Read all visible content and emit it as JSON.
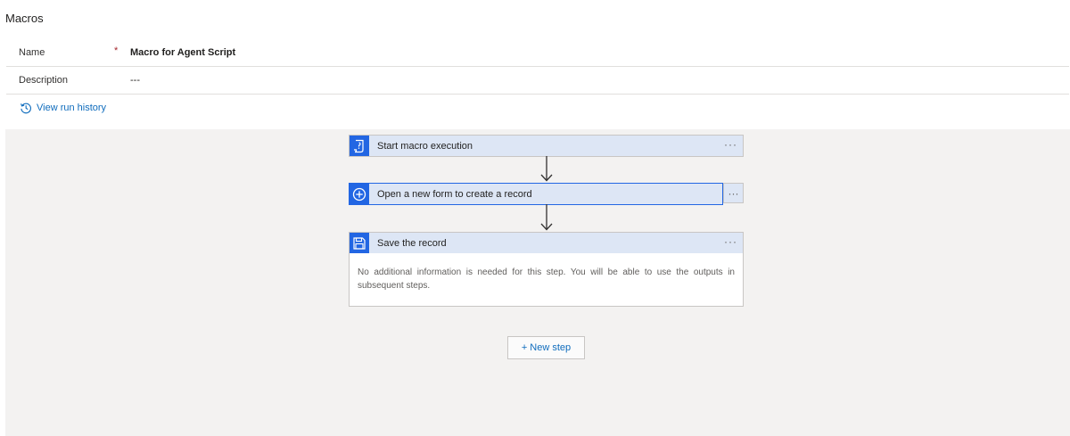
{
  "page": {
    "title": "Macros"
  },
  "form": {
    "name": {
      "label": "Name",
      "required_marker": "*",
      "value": "Macro for Agent Script"
    },
    "description": {
      "label": "Description",
      "value": "---"
    }
  },
  "run_history": {
    "label": "View run history",
    "icon": "history-icon"
  },
  "steps": [
    {
      "title": "Start macro execution",
      "icon": "script-icon",
      "more": "···"
    },
    {
      "title": "Open a new form to create a record",
      "icon": "add-circle-icon",
      "more": "···"
    },
    {
      "title": "Save the record",
      "icon": "save-icon",
      "more": "···",
      "body": "No additional information is needed for this step. You will be able to use the outputs in subsequent steps."
    }
  ],
  "new_step": {
    "label": "+ New step"
  },
  "colors": {
    "accent": "#2266e3",
    "header_bg": "#dde6f5",
    "canvas_bg": "#f3f2f1",
    "link": "#0f6cbd"
  }
}
